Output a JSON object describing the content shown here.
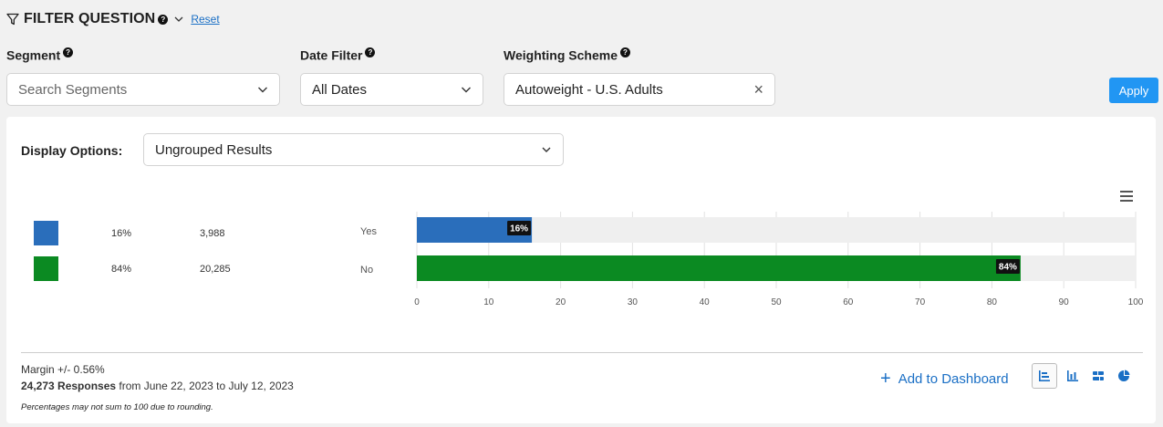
{
  "header": {
    "title": "FILTER QUESTION",
    "help": "?",
    "reset_label": "Reset"
  },
  "filters": {
    "segment": {
      "label": "Segment",
      "placeholder": "Search Segments"
    },
    "date": {
      "label": "Date Filter",
      "value": "All Dates"
    },
    "weighting": {
      "label": "Weighting Scheme",
      "value": "Autoweight - U.S. Adults",
      "clear": "×"
    },
    "apply_label": "Apply"
  },
  "display": {
    "label": "Display Options:",
    "value": "Ungrouped Results"
  },
  "rows": [
    {
      "pct": "16%",
      "count": "3,988",
      "label": "Yes",
      "color": "#2a6ebb",
      "value": 16,
      "bar_label": "16%"
    },
    {
      "pct": "84%",
      "count": "20,285",
      "label": "No",
      "color": "#0b8a22",
      "value": 84,
      "bar_label": "84%"
    }
  ],
  "chart_data": {
    "type": "bar",
    "orientation": "horizontal",
    "categories": [
      "Yes",
      "No"
    ],
    "values": [
      16,
      84
    ],
    "data_labels": [
      "16%",
      "84%"
    ],
    "colors": [
      "#2a6ebb",
      "#0b8a22"
    ],
    "xlim": [
      0,
      100
    ],
    "xticks": [
      0,
      10,
      20,
      30,
      40,
      50,
      60,
      70,
      80,
      90,
      100
    ],
    "grid": true
  },
  "footer": {
    "margin": "Margin +/- 0.56%",
    "responses_count": "24,273 Responses",
    "responses_range": " from June 22, 2023 to July 12, 2023",
    "note": "Percentages may not sum to 100 due to rounding.",
    "add_dashboard": "Add to Dashboard",
    "chart_types": [
      "horizontal-bar-chart-icon",
      "vertical-bar-chart-icon",
      "stacked-bar-chart-icon",
      "pie-chart-icon"
    ]
  },
  "colors": {
    "accent": "#1a6fc5",
    "apply": "#2196f3"
  }
}
